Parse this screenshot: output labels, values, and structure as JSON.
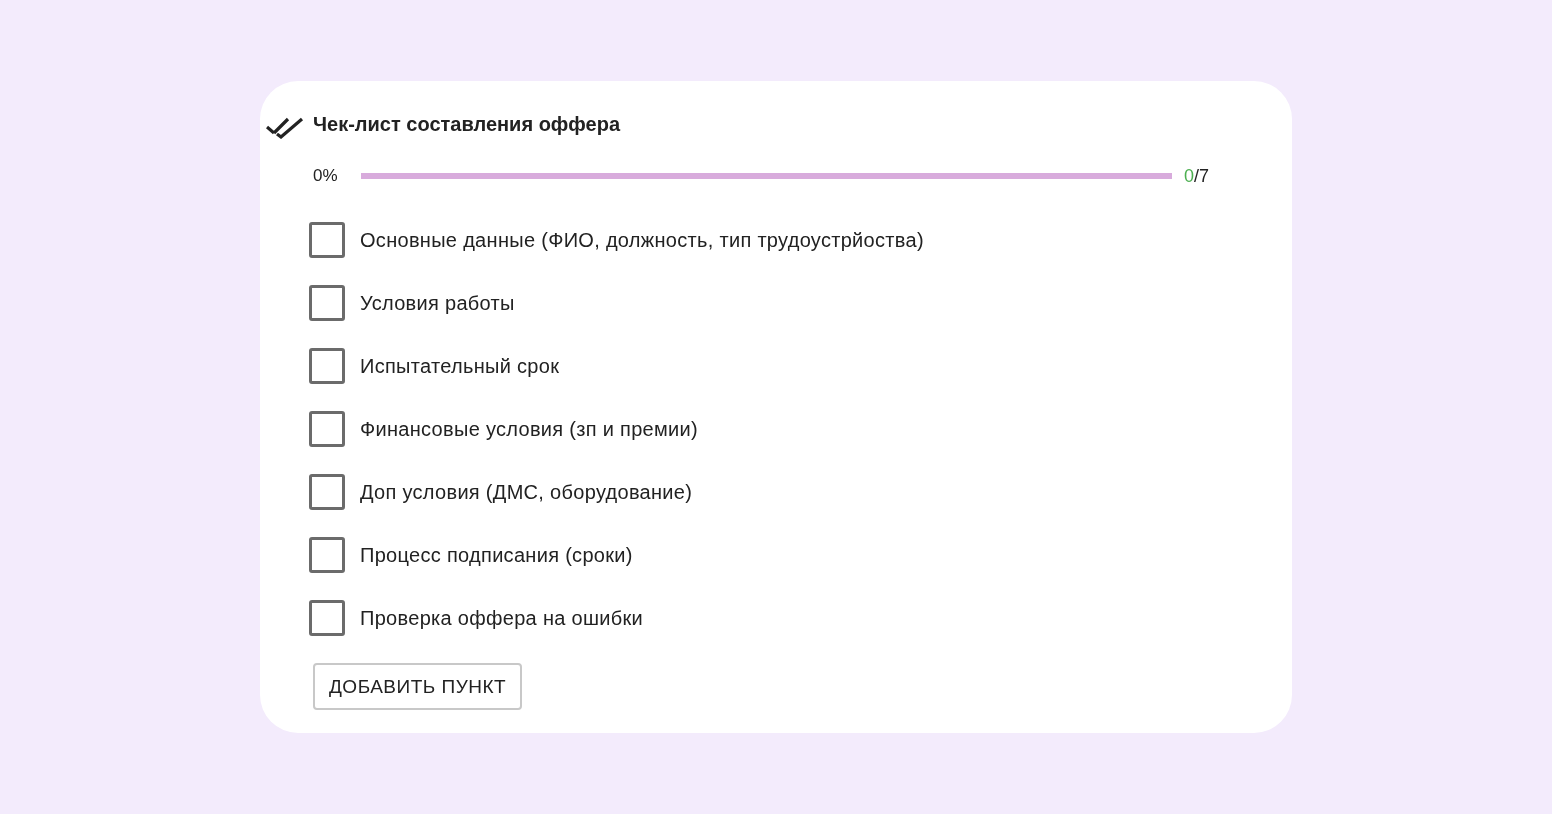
{
  "title": "Чек-лист составления оффера",
  "progress": {
    "percent": "0%",
    "level": 0,
    "done": "0",
    "total": "/7"
  },
  "items": [
    {
      "label": "Основные данные (ФИО, должность, тип трудоустрйоства)",
      "checked": false
    },
    {
      "label": "Условия работы",
      "checked": false
    },
    {
      "label": "Испытательный срок",
      "checked": false
    },
    {
      "label": "Финансовые условия (зп и премии)",
      "checked": false
    },
    {
      "label": "Доп условия (ДМС, оборудование)",
      "checked": false
    },
    {
      "label": "Процесс подписания (сроки)",
      "checked": false
    },
    {
      "label": "Проверка оффера на ошибки",
      "checked": false
    }
  ],
  "add_button": "ДОБАВИТЬ ПУНКТ"
}
